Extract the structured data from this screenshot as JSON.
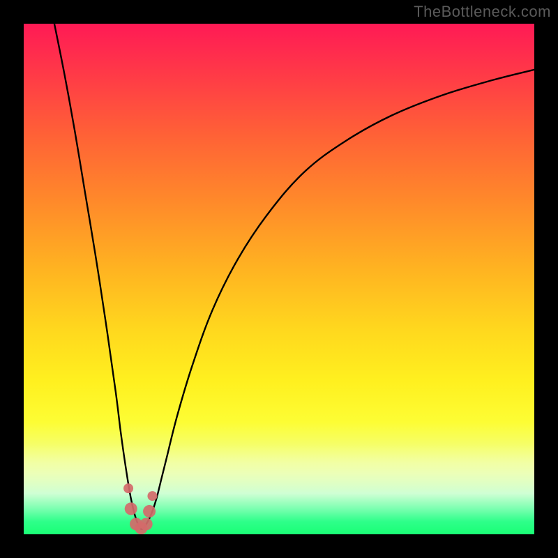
{
  "watermark": "TheBottleneck.com",
  "colors": {
    "frame": "#000000",
    "curve": "#000000",
    "marker": "#d46a6a",
    "gradient_top": "#ff1a55",
    "gradient_bottom": "#1aff75"
  },
  "chart_data": {
    "type": "line",
    "title": "",
    "xlabel": "",
    "ylabel": "",
    "xlim": [
      0,
      100
    ],
    "ylim": [
      0,
      100
    ],
    "note": "V-shaped bottleneck curve; x is normalized horizontal position (0–100), y is bottleneck percentage (0 at bottom, 100 at top). Minimum near x≈23.",
    "series": [
      {
        "name": "bottleneck-curve",
        "x": [
          6,
          8,
          10,
          12,
          14,
          16,
          18,
          19,
          20,
          21,
          22,
          23,
          24,
          25,
          26,
          27,
          28,
          30,
          33,
          37,
          42,
          48,
          55,
          63,
          72,
          82,
          92,
          100
        ],
        "y": [
          100,
          90,
          79,
          67,
          55,
          42,
          28,
          20,
          13,
          7,
          3,
          1,
          2,
          4,
          7,
          11,
          15,
          23,
          33,
          44,
          54,
          63,
          71,
          77,
          82,
          86,
          89,
          91
        ]
      }
    ],
    "markers": {
      "name": "highlight-points",
      "note": "Salmon dots/blobs near the curve minimum",
      "x": [
        20.5,
        21.0,
        22.0,
        23.0,
        24.0,
        24.6,
        25.2
      ],
      "y": [
        9.0,
        5.0,
        2.0,
        1.2,
        2.0,
        4.5,
        7.5
      ]
    }
  }
}
